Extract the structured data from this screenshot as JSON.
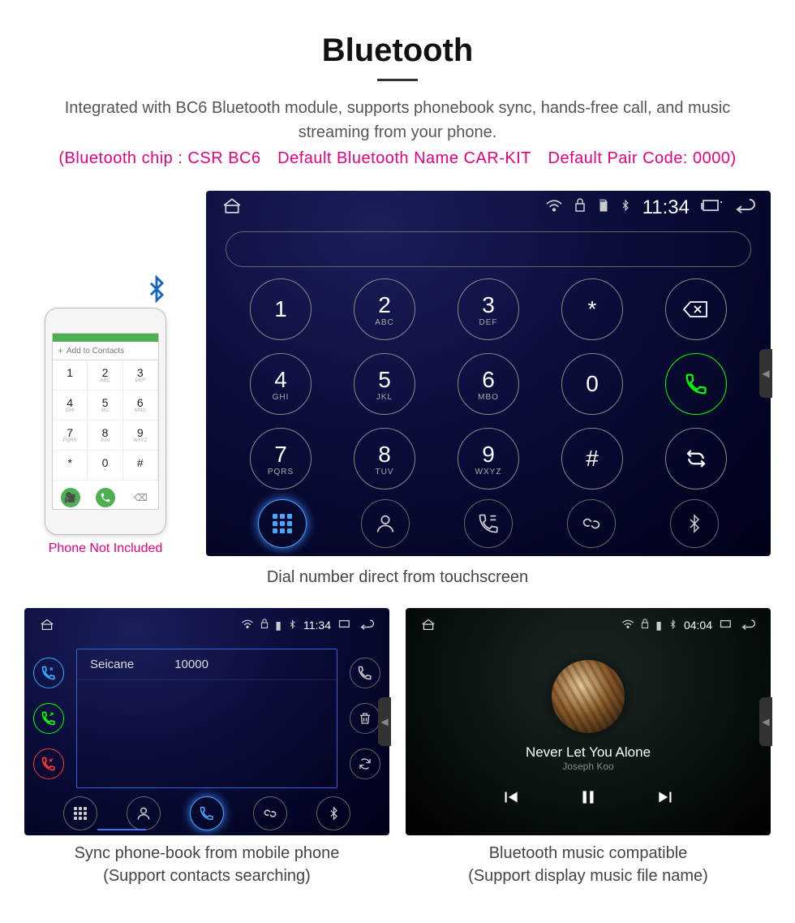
{
  "title": "Bluetooth",
  "intro": "Integrated with BC6 Bluetooth module, supports phonebook sync, hands-free call, and music streaming from your phone.",
  "subline": "(Bluetooth chip : CSR BC6 Default Bluetooth Name CAR-KIT Default Pair Code: 0000)",
  "phone": {
    "add_label": "Add to Contacts",
    "keys": [
      {
        "n": "1",
        "l": ""
      },
      {
        "n": "2",
        "l": "ABC"
      },
      {
        "n": "3",
        "l": "DEF"
      },
      {
        "n": "4",
        "l": "GHI"
      },
      {
        "n": "5",
        "l": "JKL"
      },
      {
        "n": "6",
        "l": "MNO"
      },
      {
        "n": "7",
        "l": "PQRS"
      },
      {
        "n": "8",
        "l": "TUV"
      },
      {
        "n": "9",
        "l": "WXYZ"
      },
      {
        "n": "*",
        "l": ""
      },
      {
        "n": "0",
        "l": "+"
      },
      {
        "n": "#",
        "l": ""
      }
    ],
    "note": "Phone Not Included"
  },
  "headunit_clock": "11:34",
  "dialer": {
    "keys": [
      {
        "n": "1",
        "l": ""
      },
      {
        "n": "2",
        "l": "ABC"
      },
      {
        "n": "3",
        "l": "DEF"
      },
      {
        "n": "*",
        "l": ""
      },
      {
        "icon": "backspace"
      },
      {
        "n": "4",
        "l": "GHI"
      },
      {
        "n": "5",
        "l": "JKL"
      },
      {
        "n": "6",
        "l": "MBO"
      },
      {
        "n": "0",
        "l": ""
      },
      {
        "icon": "call"
      },
      {
        "n": "7",
        "l": "PQRS"
      },
      {
        "n": "8",
        "l": "TUV"
      },
      {
        "n": "9",
        "l": "WXYZ"
      },
      {
        "n": "#",
        "l": ""
      },
      {
        "icon": "swap"
      }
    ],
    "caption": "Dial number direct from touchscreen"
  },
  "contacts": {
    "clock": "11:34",
    "name": "Seicane",
    "number": "10000",
    "caption_line1": "Sync phone-book from mobile phone",
    "caption_line2": "(Support contacts searching)"
  },
  "music": {
    "clock": "04:04",
    "title": "Never Let You Alone",
    "artist": "Joseph Koo",
    "caption_line1": "Bluetooth music compatible",
    "caption_line2": "(Support display music file name)"
  }
}
